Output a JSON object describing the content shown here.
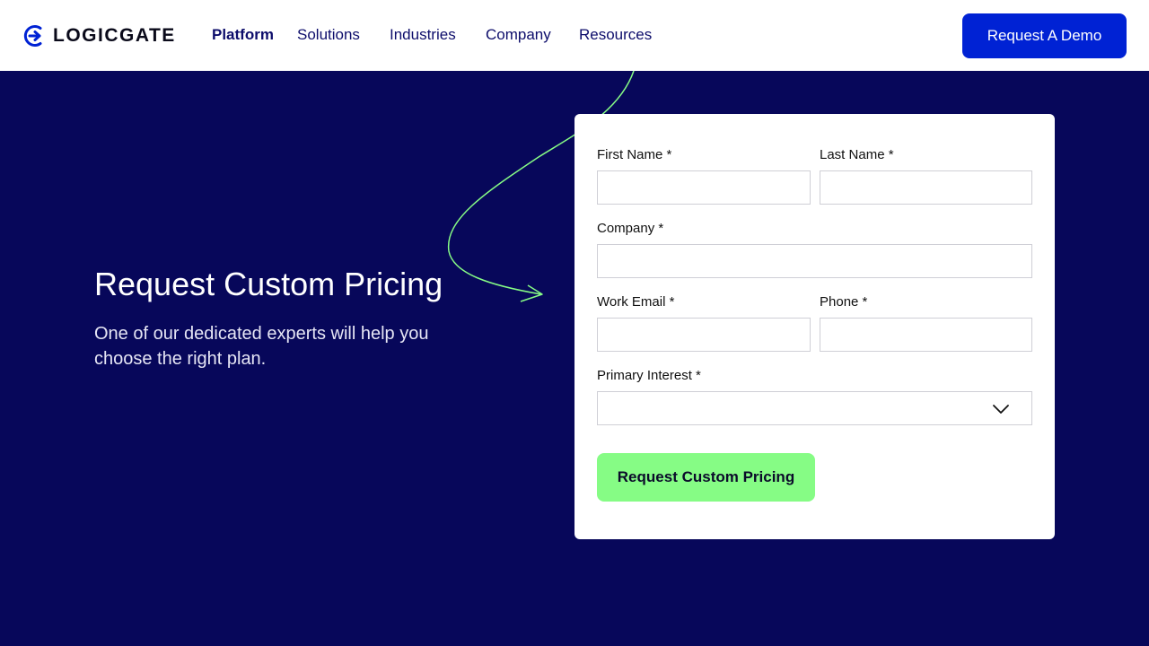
{
  "brand": {
    "name": "LOGICGATE",
    "logo_icon": "logicgate-logo-icon",
    "color": "#0022d4"
  },
  "nav": {
    "items": [
      {
        "label": "Platform",
        "active": true
      },
      {
        "label": "Solutions"
      },
      {
        "label": "Industries"
      },
      {
        "label": "Company"
      },
      {
        "label": "Resources"
      }
    ],
    "cta_label": "Request A Demo"
  },
  "hero": {
    "title": "Request Custom Pricing",
    "subtitle": "One of our dedicated experts will help you choose the right plan."
  },
  "form": {
    "first_name": {
      "label": "First Name *",
      "value": "",
      "placeholder": ""
    },
    "last_name": {
      "label": "Last Name *",
      "value": "",
      "placeholder": ""
    },
    "company": {
      "label": "Company *",
      "value": "",
      "placeholder": ""
    },
    "work_email": {
      "label": "Work Email *",
      "value": "",
      "placeholder": ""
    },
    "phone": {
      "label": "Phone *",
      "value": "",
      "placeholder": ""
    },
    "primary_interest": {
      "label": "Primary Interest *",
      "selected": "",
      "icon": "chevron-down-icon"
    },
    "submit_label": "Request Custom Pricing"
  },
  "colors": {
    "background": "#07075a",
    "accent_green": "#86fc85",
    "cta_blue": "#0022d4"
  }
}
